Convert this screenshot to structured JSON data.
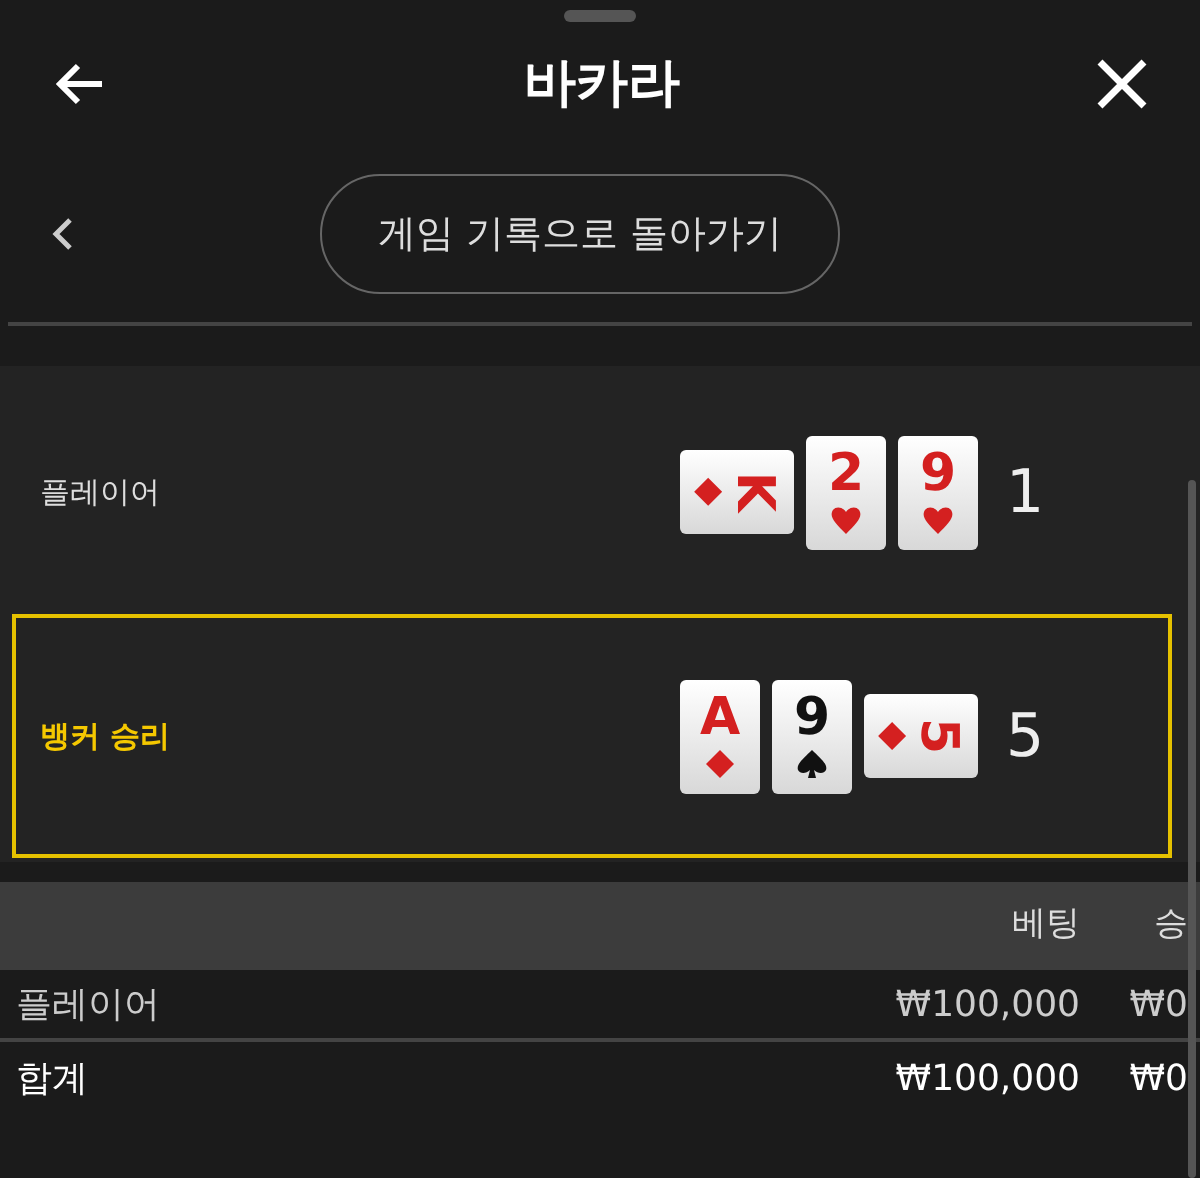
{
  "header": {
    "title": "바카라"
  },
  "back_button": {
    "label": "게임 기록으로 돌아가기"
  },
  "hands": [
    {
      "label": "플레이어",
      "winner": false,
      "total": "1",
      "cards": [
        {
          "rank": "K",
          "kind": "diamond",
          "sideways": true
        },
        {
          "rank": "2",
          "kind": "heart",
          "sideways": false
        },
        {
          "rank": "9",
          "kind": "heart",
          "sideways": false
        }
      ]
    },
    {
      "label": "뱅커 승리",
      "winner": true,
      "total": "5",
      "cards": [
        {
          "rank": "A",
          "kind": "diamond",
          "sideways": false
        },
        {
          "rank": "9",
          "kind": "spade",
          "sideways": false
        },
        {
          "rank": "5",
          "kind": "diamond",
          "sideways": true
        }
      ]
    }
  ],
  "table": {
    "columns": [
      "베팅",
      "승"
    ],
    "rows": [
      {
        "kind": "bet",
        "label": "플레이어",
        "cells": [
          "₩100,000",
          "₩0"
        ]
      },
      {
        "kind": "total",
        "label": "합계",
        "cells": [
          "₩100,000",
          "₩0"
        ]
      }
    ]
  }
}
